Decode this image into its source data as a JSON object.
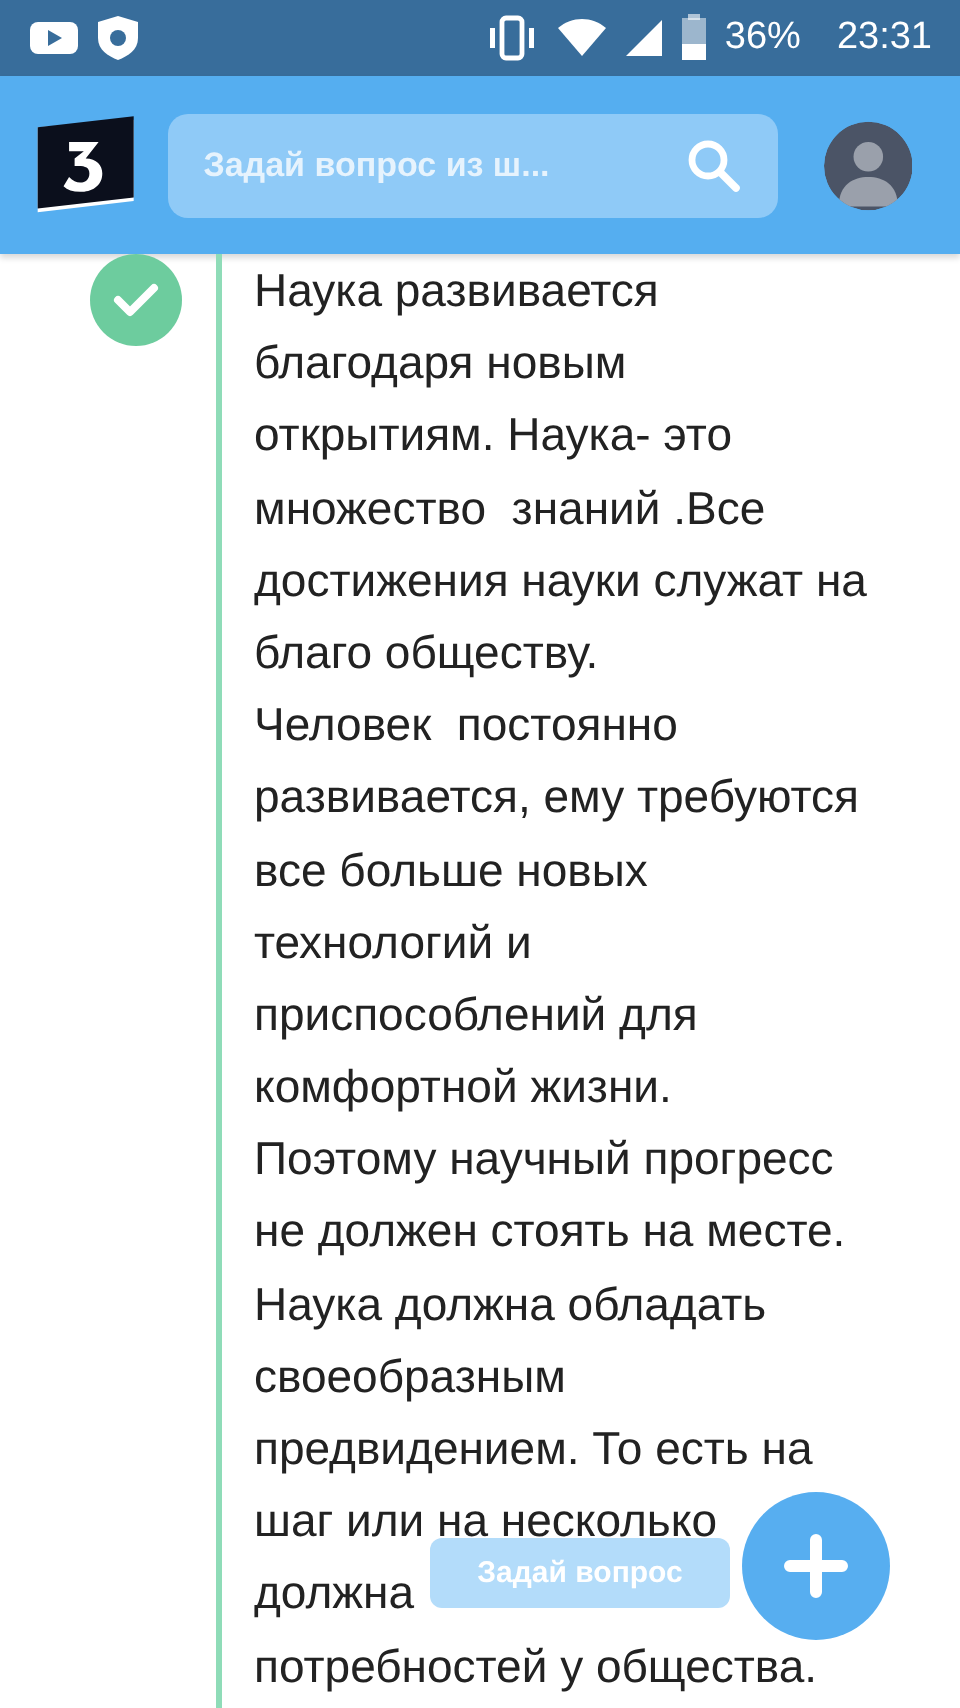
{
  "status_bar": {
    "battery": "36%",
    "time": "23:31"
  },
  "header": {
    "search": {
      "placeholder": "Задай вопрос из ш..."
    }
  },
  "answer": {
    "verified": true,
    "lines": [
      "Наука развивается",
      "благодаря новым",
      "открытиям. Наука- это",
      "множество  знаний .Все",
      "достижения науки служат на",
      "благо обществу.",
      "Человек  постоянно",
      "развивается, ему требуются",
      "все больше новых",
      "технологий и",
      "приспособлений для",
      "комфортной жизни.",
      "Поэтому научный прогресс",
      "не должен стоять на месте.",
      "Наука должна обладать",
      "своеобразным",
      "предвидением. То есть на",
      "шаг или на несколько",
      "должна",
      "потребностей у общества."
    ]
  },
  "ask_button": {
    "label": "Задай вопрос"
  }
}
